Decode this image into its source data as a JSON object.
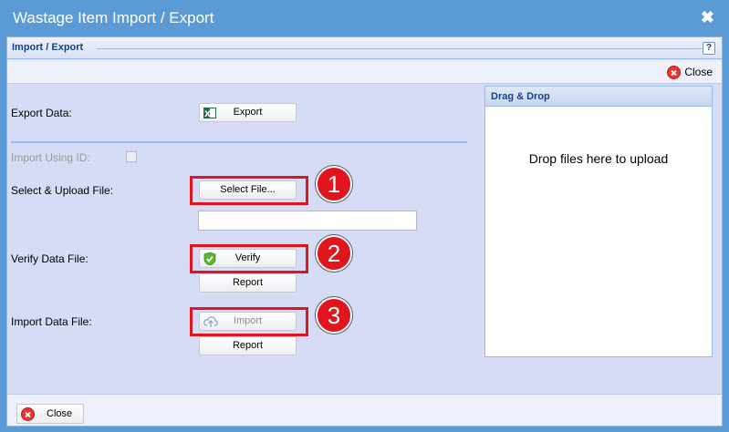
{
  "window": {
    "title": "Wastage Item Import / Export",
    "close_glyph": "✖"
  },
  "panel": {
    "title": "Import / Export",
    "help_glyph": "?"
  },
  "toolbar": {
    "close_label": "Close"
  },
  "form": {
    "export_label": "Export Data:",
    "export_button": "Export",
    "import_using_id_label": "Import Using ID:",
    "select_upload_label": "Select & Upload File:",
    "select_file_button": "Select File...",
    "file_name_value": "",
    "verify_label": "Verify Data File:",
    "verify_button": "Verify",
    "verify_report_button": "Report",
    "import_label": "Import Data File:",
    "import_button": "Import",
    "import_report_button": "Report"
  },
  "annotations": {
    "step1": "1",
    "step2": "2",
    "step3": "3",
    "highlight_color": "#e0151d"
  },
  "drag_drop": {
    "title": "Drag & Drop",
    "prompt": "Drop files here to upload"
  },
  "footer": {
    "close_label": "Close"
  },
  "icons": {
    "export": "excel-icon",
    "verify": "shield-check-icon",
    "import": "cloud-upload-icon",
    "close": "close-circle-icon"
  },
  "colors": {
    "titlebar": "#5b9bd5",
    "background": "#d6dcf5",
    "accent": "#15428b"
  }
}
